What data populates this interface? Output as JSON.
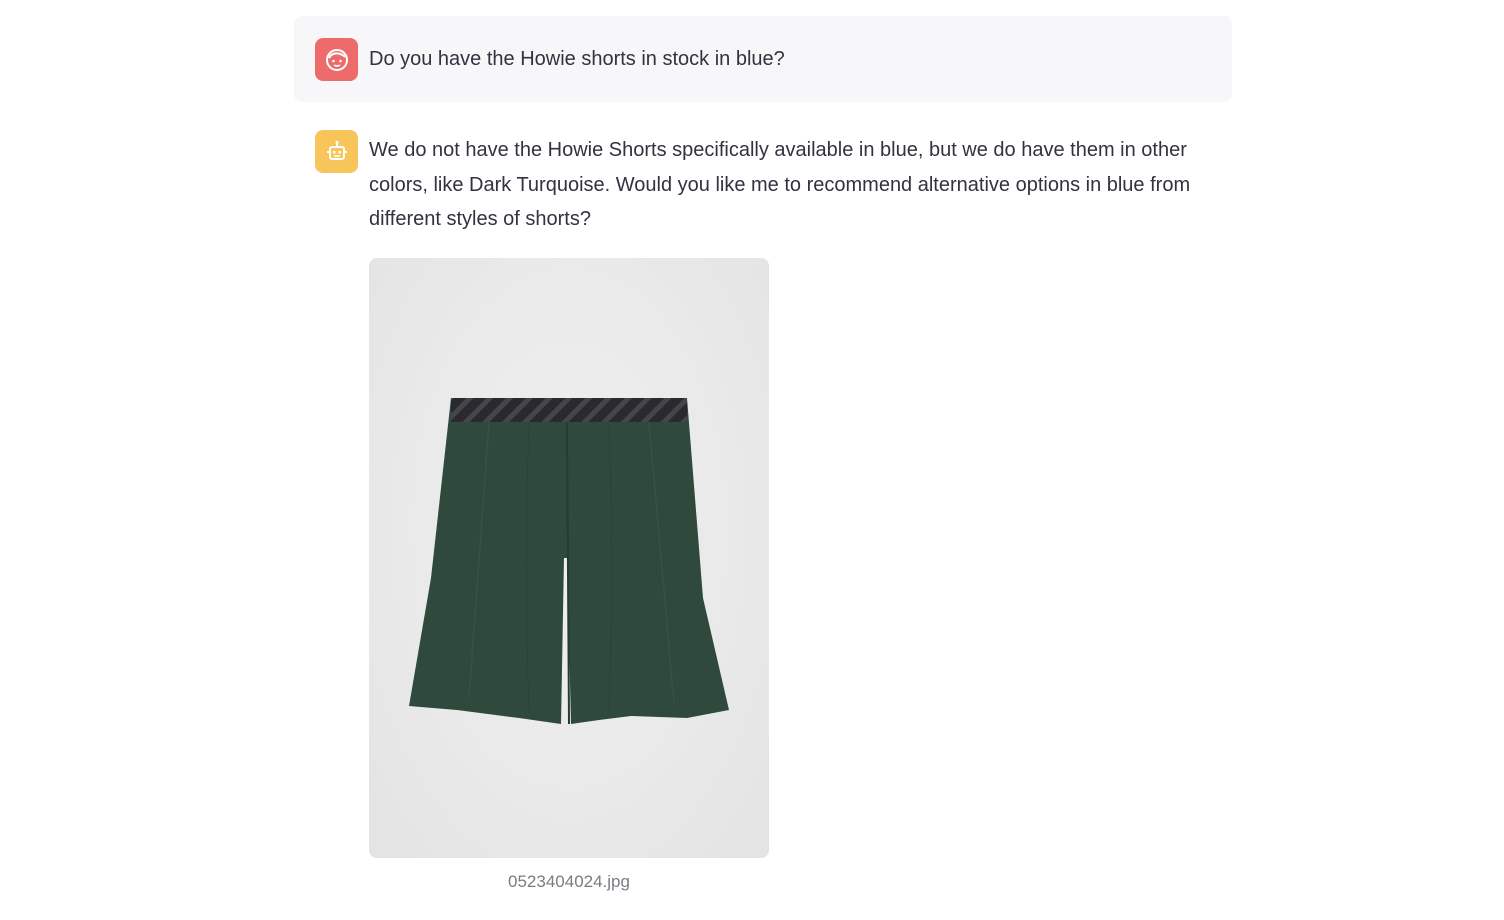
{
  "conversation": {
    "user_message": {
      "avatar_icon": "user-face-icon",
      "avatar_color": "#ee6b6b",
      "text": "Do you have the Howie shorts in stock in blue?"
    },
    "assistant_message": {
      "avatar_icon": "robot-icon",
      "avatar_color": "#f7c55a",
      "text": "We do not have the Howie Shorts specifically available in blue, but we do have them in other colors, like Dark Turquoise. Would you like me to recommend alternative options in blue from different styles of shorts?",
      "image": {
        "caption": "0523404024.jpg",
        "shorts_color": "#2f4a3c",
        "waistband_color": "#2a2a2e"
      }
    }
  }
}
